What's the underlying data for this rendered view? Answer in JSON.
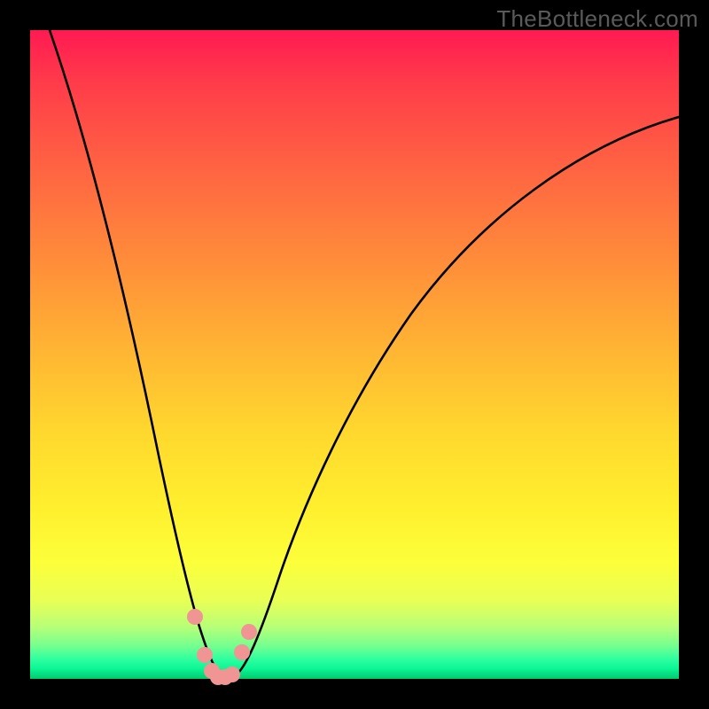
{
  "watermark_text": "TheBottleneck.com",
  "chart_data": {
    "type": "line",
    "title": "",
    "xlabel": "",
    "ylabel": "",
    "xlim": [
      0,
      100
    ],
    "ylim": [
      0,
      100
    ],
    "background_gradient": {
      "direction": "vertical",
      "description": "bottleneck severity heatmap: red (high) at top → green (none) at bottom",
      "stops": [
        {
          "pos": 0.0,
          "color": "#ff1a52"
        },
        {
          "pos": 0.5,
          "color": "#ffb733"
        },
        {
          "pos": 0.82,
          "color": "#fcff3a"
        },
        {
          "pos": 0.97,
          "color": "#2dffa0"
        },
        {
          "pos": 1.0,
          "color": "#02c96a"
        }
      ]
    },
    "series": [
      {
        "name": "bottleneck-curve",
        "description": "V-shaped bottleneck percentage curve; minimum is the optimal balance point",
        "x_approx": [
          3,
          10,
          17,
          22.5,
          26,
          28,
          29.5,
          31,
          34,
          40,
          50,
          65,
          82,
          100
        ],
        "y_approx": [
          100,
          74,
          44,
          19,
          6,
          1,
          0,
          1,
          7,
          22,
          44,
          64,
          78,
          86
        ]
      }
    ],
    "markers": {
      "name": "highlighted-data-points",
      "color": "#f09494",
      "points_approx": [
        {
          "x": 25.5,
          "y": 9.5
        },
        {
          "x": 27.0,
          "y": 4.0
        },
        {
          "x": 28.0,
          "y": 1.0
        },
        {
          "x": 29.0,
          "y": 0.0
        },
        {
          "x": 30.0,
          "y": 0.0
        },
        {
          "x": 31.1,
          "y": 1.0
        },
        {
          "x": 32.7,
          "y": 4.5
        },
        {
          "x": 33.8,
          "y": 8.0
        }
      ]
    },
    "minimum_at_x_approx": 29.5,
    "grid": false,
    "legend": false
  }
}
